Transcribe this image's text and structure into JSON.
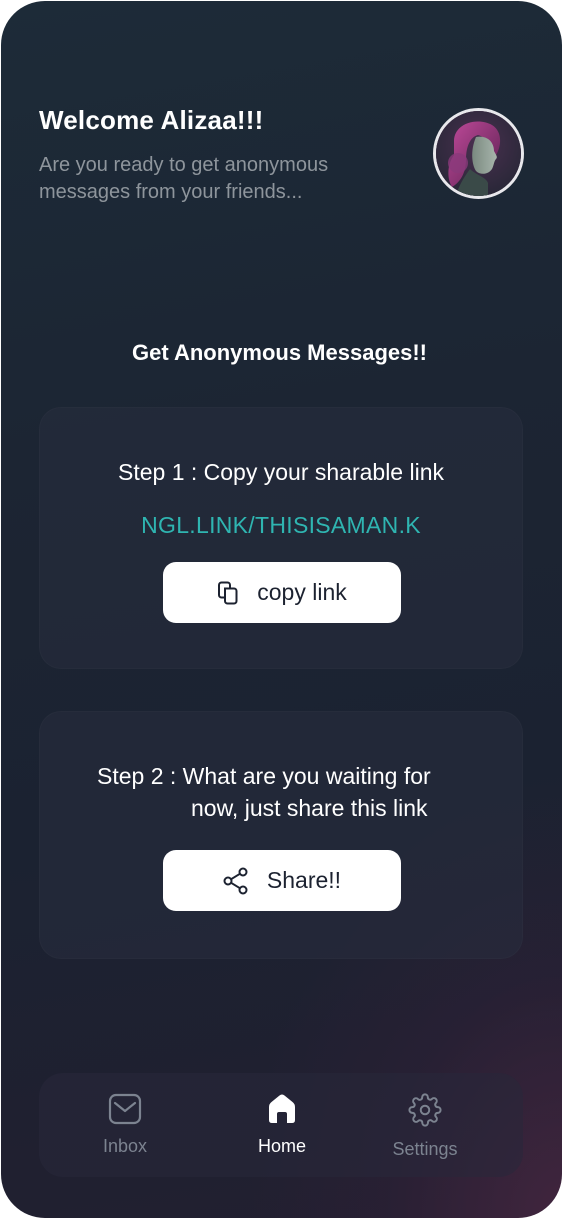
{
  "header": {
    "title": "Welcome Alizaa!!!",
    "subtitle": "Are you ready to get anonymous messages from your friends..."
  },
  "avatar": {
    "icon": "user-avatar-photo"
  },
  "section": {
    "title": "Get Anonymous Messages!!"
  },
  "step1": {
    "text": "Step 1 : Copy your sharable link",
    "link": "NGL.LINK/THISISAMAN.K",
    "button_label": "copy link",
    "button_icon": "copy-icon"
  },
  "step2": {
    "text_line1": "Step 2 : What are you waiting for",
    "text_line2": "now, just share this link",
    "button_label": "Share!!",
    "button_icon": "share-icon"
  },
  "nav": {
    "items": [
      {
        "label": "Inbox",
        "icon": "inbox-icon",
        "active": false
      },
      {
        "label": "Home",
        "icon": "home-icon",
        "active": true
      },
      {
        "label": "Settings",
        "icon": "gear-icon",
        "active": false
      }
    ]
  },
  "colors": {
    "accent_link": "#2fb5b1",
    "subtitle": "#8e959c",
    "nav_inactive": "#7c8390",
    "nav_active": "#ffffff"
  }
}
